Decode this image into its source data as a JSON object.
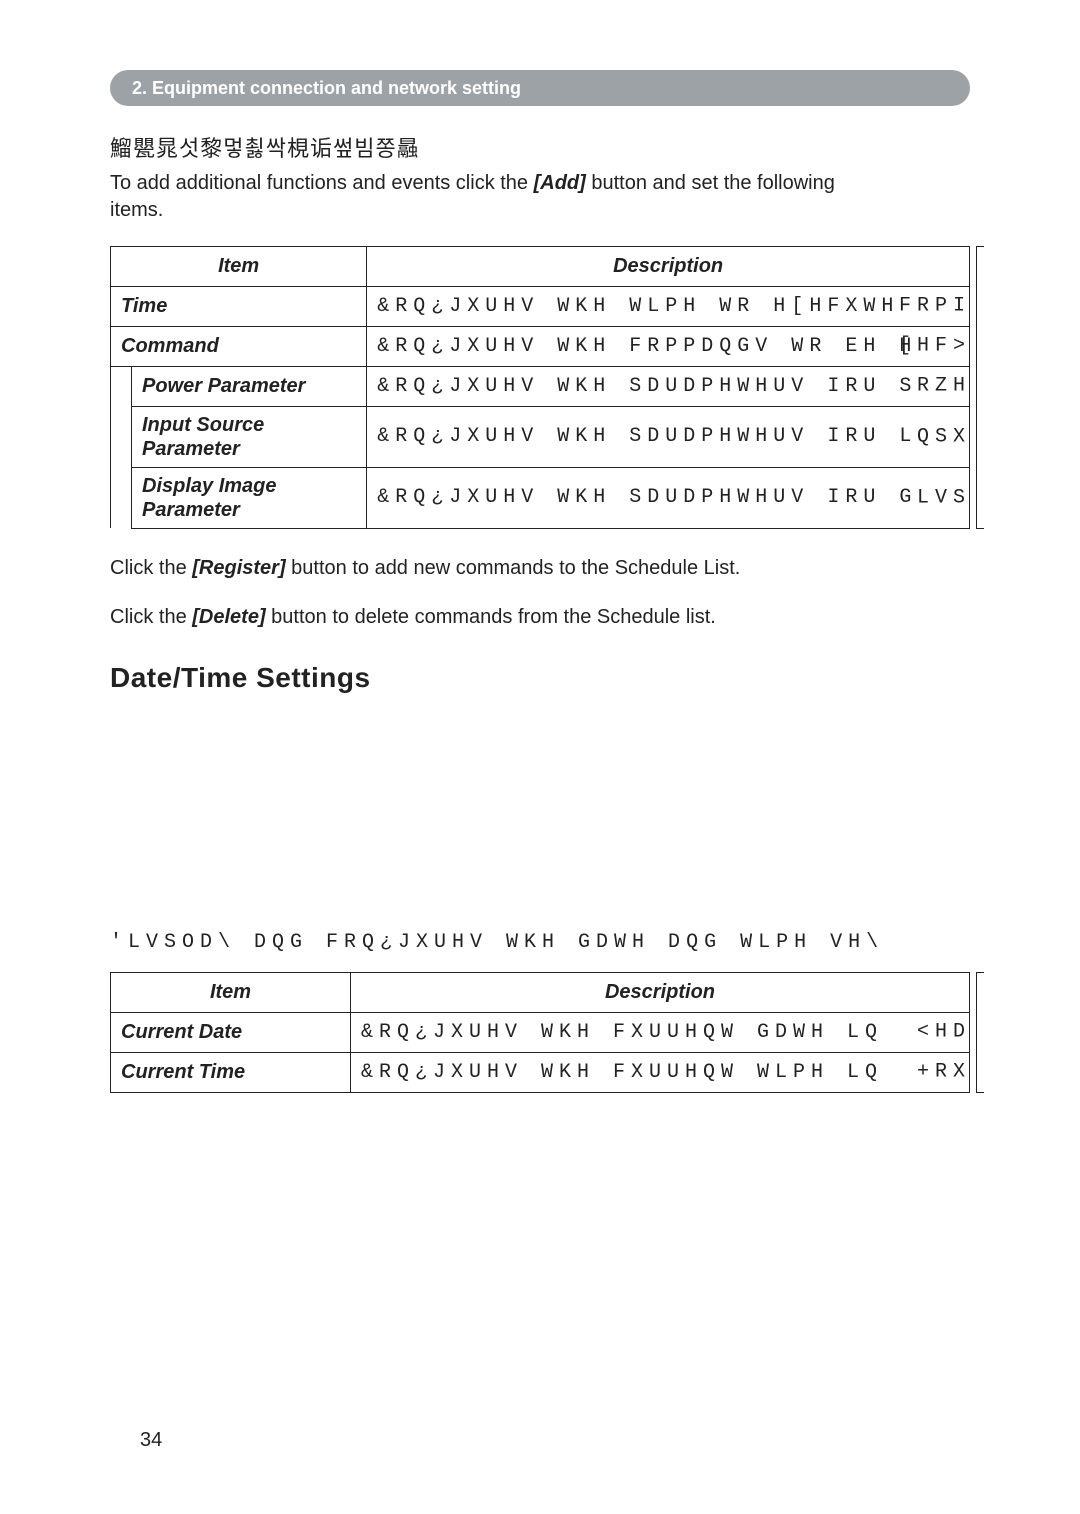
{
  "chapter_bar": "2. Equipment connection and network setting",
  "cjk_line": "鰡甖晁섯黎멓쵫싹梘诟쎂빔쫑曧",
  "intro_prefix": "To add additional functions and events click the ",
  "intro_button": "[Add]",
  "intro_suffix_1": " button and set the following ",
  "intro_suffix_2": "items.",
  "table1": {
    "head_item": "Item",
    "head_desc": "Description",
    "rows": [
      {
        "label": "Time",
        "desc": "&RQ¿JXUHV WKH WLPH WR H[HFXWH",
        "bleed": "FRPI",
        "indent": false
      },
      {
        "label": "Command",
        "desc": "&RQ¿JXUHV WKH FRPPDQGV WR EH H",
        "bleed": "[HF>",
        "indent": false
      },
      {
        "label": "Power Parameter",
        "desc": "&RQ¿JXUHV WKH SDUDPHWHUV IRU S",
        "bleed": "RZH",
        "indent": true
      },
      {
        "label": "Input Source\nParameter",
        "desc": "&RQ¿JXUHV WKH SDUDPHWHUV IRU L",
        "bleed": "QSX",
        "indent": true
      },
      {
        "label": "Display Image\nParameter",
        "desc": "&RQ¿JXUHV WKH SDUDPHWHUV IRU G",
        "bleed": "LVS",
        "indent": true
      }
    ]
  },
  "para1_prefix": "Click the ",
  "para1_button": "[Register]",
  "para1_suffix": " button to add new commands to the Schedule List.",
  "para2_prefix": "Click the ",
  "para2_button": "[Delete]",
  "para2_suffix": " button to delete commands from the Schedule list.",
  "section_heading": "Date/Time Settings",
  "config_line": "'LVSOD\\ DQG FRQ¿JXUHV WKH GDWH DQG WLPH VH\\",
  "table2": {
    "head_item": "Item",
    "head_desc": "Description",
    "rows": [
      {
        "label": "Current Date",
        "desc": "&RQ¿JXUHV WKH FXUUHQW GDWH LQ",
        "bleed": "<HD"
      },
      {
        "label": "Current Time",
        "desc": "&RQ¿JXUHV WKH FXUUHQW WLPH LQ",
        "bleed": "+RX"
      }
    ]
  },
  "page_number": "34"
}
